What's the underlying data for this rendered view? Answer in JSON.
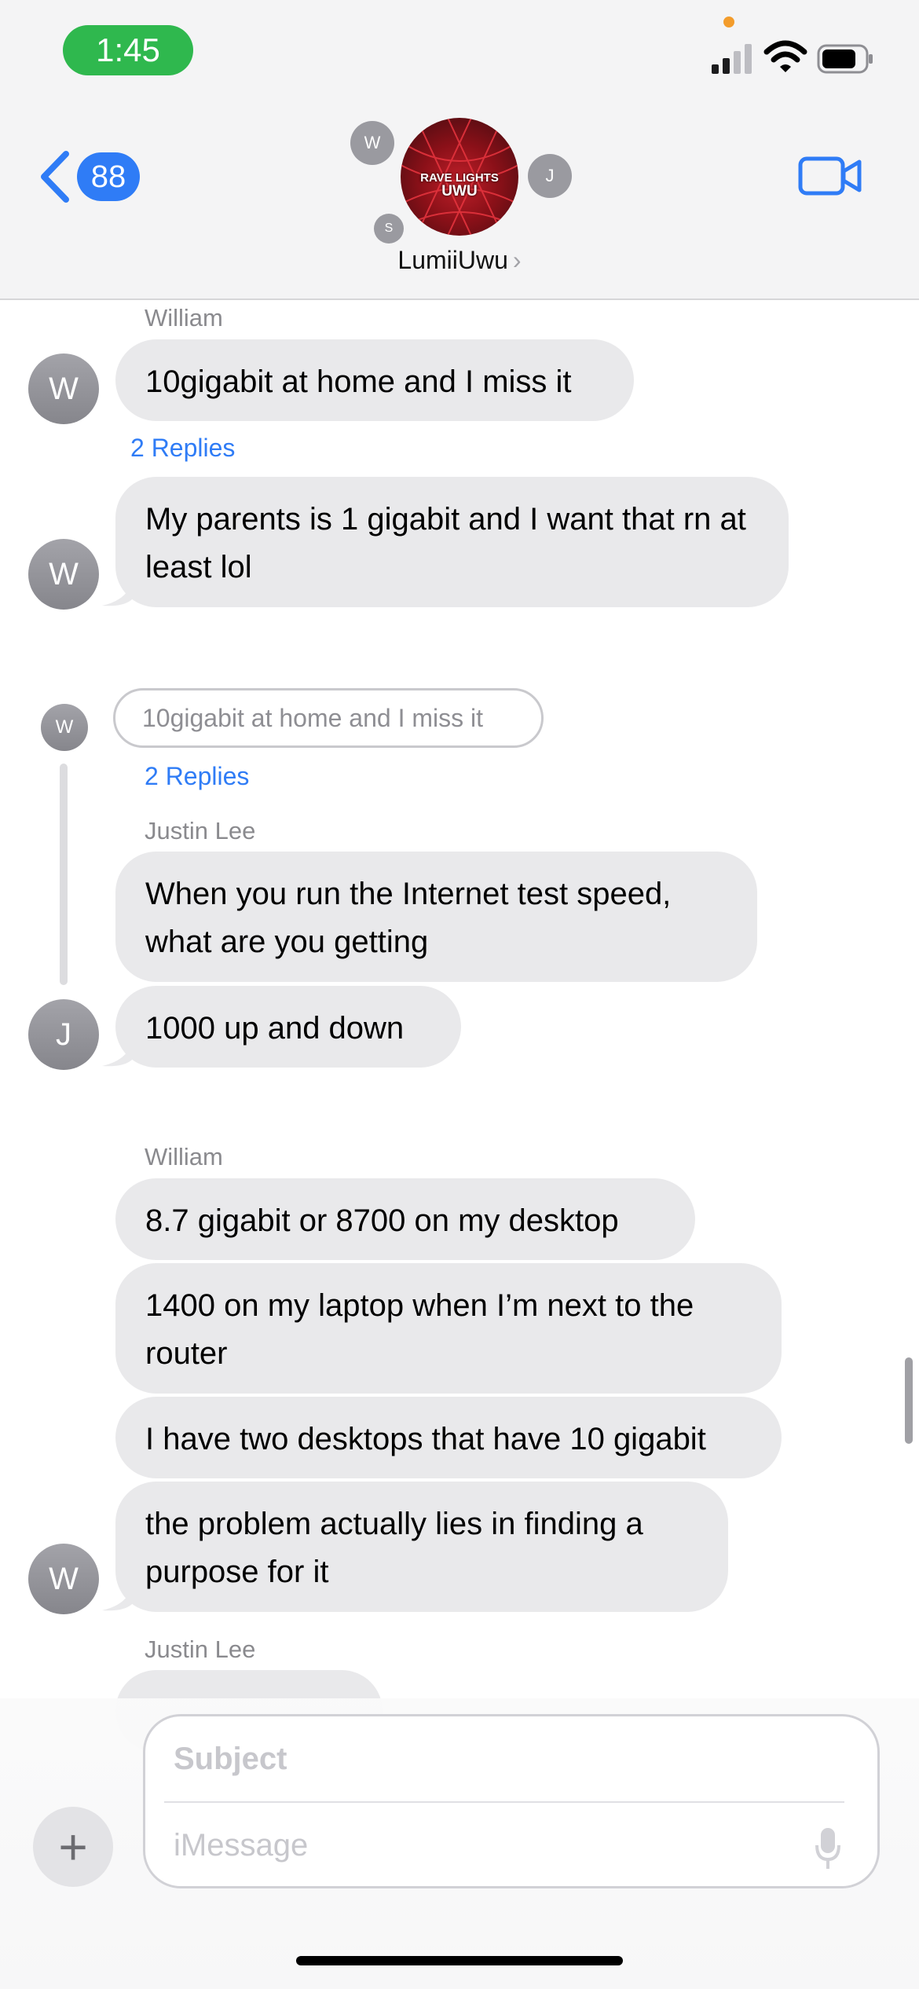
{
  "status_bar": {
    "time": "1:45"
  },
  "nav": {
    "back_count": "88",
    "group_name": "LumiiUwu",
    "group_name_chevron": "›",
    "participants": [
      "W",
      "J",
      "S"
    ],
    "photo_text_line1": "RAVE LIGHTS",
    "photo_text_line2": "UWU"
  },
  "messages": [
    {
      "sender": "William",
      "avatar": "W",
      "text": "10gigabit at home and I miss it",
      "replies": "2 Replies"
    },
    {
      "avatar": "W",
      "text": "My parents is 1 gigabit and I want that rn at least lol"
    }
  ],
  "thread": {
    "avatar": "W",
    "quoted": "10gigabit at home and I miss it",
    "replies": "2 Replies",
    "sender": "Justin Lee",
    "avatar_reply": "J",
    "messages": [
      "When you run the Internet test speed, what are you getting",
      "1000 up and down"
    ]
  },
  "william_block": {
    "sender": "William",
    "avatar": "W",
    "messages": [
      "8.7 gigabit or 8700 on my desktop",
      "1400 on my laptop when I’m next to the router",
      "I have two desktops that have 10 gigabit",
      "the problem actually lies in finding a purpose for it"
    ]
  },
  "last_sender": "Justin Lee",
  "composer": {
    "subject_placeholder": "Subject",
    "message_placeholder": "iMessage",
    "plus": "+"
  },
  "colors": {
    "accent": "#2f7cf6",
    "bubble": "#e9e9eb",
    "time_pill": "#2fb84e"
  },
  "icons": [
    "back-chevron-icon",
    "video-camera-icon",
    "signal-icon",
    "wifi-icon",
    "battery-icon",
    "microphone-icon",
    "plus-icon"
  ]
}
